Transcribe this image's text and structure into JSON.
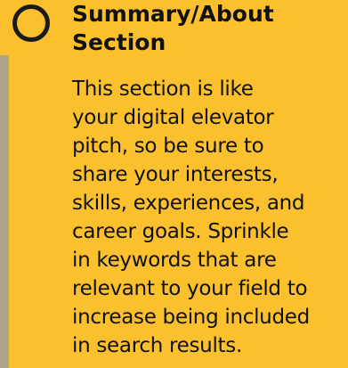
{
  "section": {
    "title_lines": [
      "Summary/About",
      "Section"
    ],
    "body_lines": [
      "This section is like",
      "your digital elevator",
      "pitch, so be sure to",
      "share your interests,",
      "skills, experiences, and",
      "career goals. Sprinkle",
      "in keywords that are",
      "relevant to your field to",
      "increase being included",
      "in search results."
    ],
    "icon": "circle-outline-icon"
  },
  "colors": {
    "card_background": "#fbc02d",
    "text": "#111111",
    "left_rule": "#b0a48a"
  }
}
